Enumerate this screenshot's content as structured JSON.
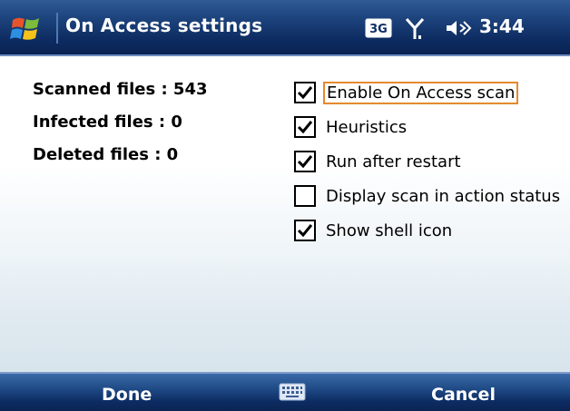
{
  "title_bar": {
    "title": "On Access settings",
    "network": "3G",
    "time": "3:44",
    "icons": [
      "windows-start-icon",
      "3g-icon",
      "signal-antenna-icon",
      "volume-icon"
    ]
  },
  "stats": {
    "scanned": "Scanned files : 543",
    "infected": "Infected files : 0",
    "deleted": "Deleted files : 0"
  },
  "options": [
    {
      "label": "Enable On Access scan",
      "checked": true,
      "focused": true
    },
    {
      "label": "Heuristics",
      "checked": true,
      "focused": false
    },
    {
      "label": "Run after restart",
      "checked": true,
      "focused": false
    },
    {
      "label": "Display scan in action status",
      "checked": false,
      "focused": false
    },
    {
      "label": "Show shell icon",
      "checked": true,
      "focused": false
    }
  ],
  "softkeys": {
    "left": "Done",
    "right": "Cancel",
    "center_icon": "keyboard-icon"
  },
  "colors": {
    "titlebar": "#1f4680",
    "softbar": "#1f4a86",
    "focus_border": "#e6892e"
  }
}
